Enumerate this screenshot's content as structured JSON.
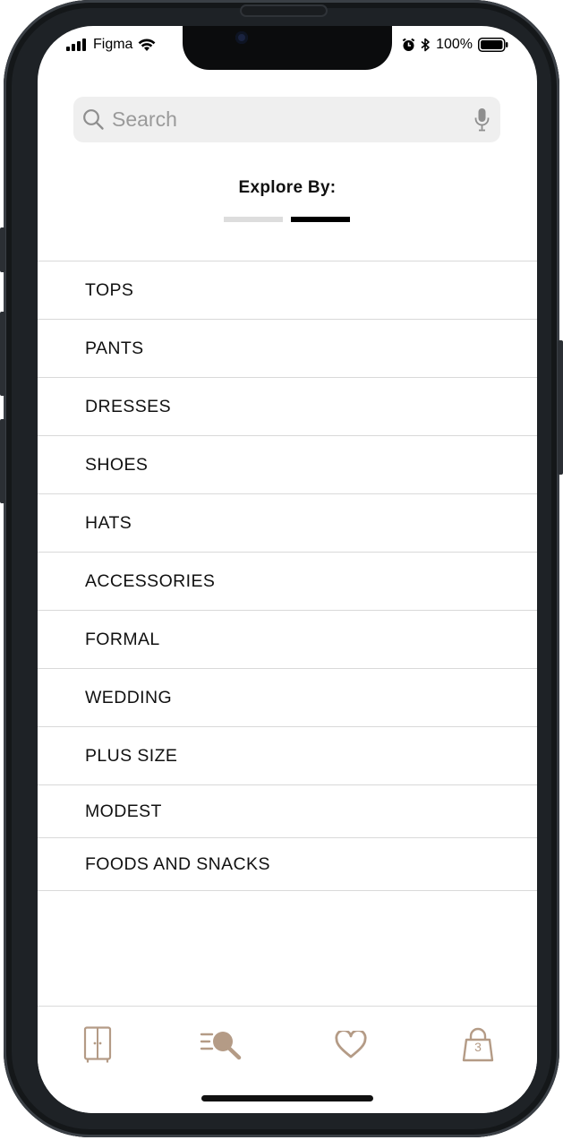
{
  "status_bar": {
    "carrier": "Figma",
    "battery": "100%"
  },
  "search": {
    "placeholder": "Search"
  },
  "explore": {
    "title": "Explore By:"
  },
  "categories": [
    "TOPS",
    "PANTS",
    "DRESSES",
    "SHOES",
    "HATS",
    "ACCESSORIES",
    "FORMAL",
    "WEDDING",
    "PLUS SIZE",
    "MODEST",
    "FOODS AND SNACKS"
  ],
  "tab_bar": {
    "icons": [
      "wardrobe-icon",
      "search-list-icon",
      "heart-icon",
      "shopping-bag-icon"
    ],
    "bag_count": "3"
  },
  "colors": {
    "accent": "#b49b86",
    "indicator_active": "#000000",
    "indicator_inactive": "#dddddd",
    "search_bg": "#efefef"
  }
}
